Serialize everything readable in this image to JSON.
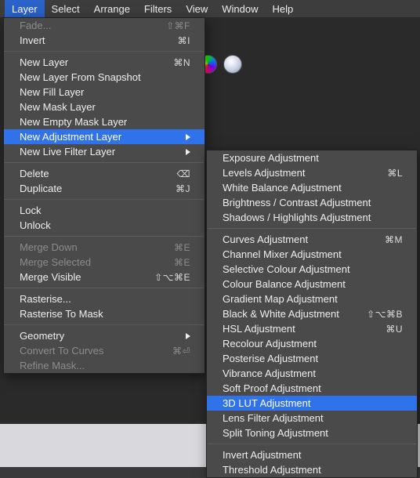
{
  "menubar": {
    "items": [
      "Layer",
      "Select",
      "Arrange",
      "Filters",
      "View",
      "Window",
      "Help"
    ],
    "active_index": 0
  },
  "layer_menu": {
    "groups": [
      [
        {
          "label": "Fade...",
          "shortcut": "⇧⌘F",
          "disabled": true
        },
        {
          "label": "Invert",
          "shortcut": "⌘I"
        }
      ],
      [
        {
          "label": "New Layer",
          "shortcut": "⌘N"
        },
        {
          "label": "New Layer From Snapshot"
        },
        {
          "label": "New Fill Layer"
        },
        {
          "label": "New Mask Layer"
        },
        {
          "label": "New Empty Mask Layer"
        },
        {
          "label": "New Adjustment Layer",
          "submenu": true,
          "highlight": true
        },
        {
          "label": "New Live Filter Layer",
          "submenu": true
        }
      ],
      [
        {
          "label": "Delete",
          "shortcut": "⌫"
        },
        {
          "label": "Duplicate",
          "shortcut": "⌘J"
        }
      ],
      [
        {
          "label": "Lock"
        },
        {
          "label": "Unlock"
        }
      ],
      [
        {
          "label": "Merge Down",
          "shortcut": "⌘E",
          "disabled": true
        },
        {
          "label": "Merge Selected",
          "shortcut": "⌘E",
          "disabled": true
        },
        {
          "label": "Merge Visible",
          "shortcut": "⇧⌥⌘E"
        }
      ],
      [
        {
          "label": "Rasterise..."
        },
        {
          "label": "Rasterise To Mask"
        }
      ],
      [
        {
          "label": "Geometry",
          "submenu": true
        },
        {
          "label": "Convert To Curves",
          "shortcut": "⌘⏎",
          "disabled": true
        },
        {
          "label": "Refine Mask...",
          "disabled": true
        }
      ]
    ]
  },
  "adjustment_submenu": {
    "groups": [
      [
        {
          "label": "Exposure Adjustment"
        },
        {
          "label": "Levels Adjustment",
          "shortcut": "⌘L"
        },
        {
          "label": "White Balance Adjustment"
        },
        {
          "label": "Brightness / Contrast Adjustment"
        },
        {
          "label": "Shadows / Highlights Adjustment"
        }
      ],
      [
        {
          "label": "Curves Adjustment",
          "shortcut": "⌘M"
        },
        {
          "label": "Channel Mixer Adjustment"
        },
        {
          "label": "Selective Colour Adjustment"
        },
        {
          "label": "Colour Balance Adjustment"
        },
        {
          "label": "Gradient Map Adjustment"
        },
        {
          "label": "Black & White Adjustment",
          "shortcut": "⇧⌥⌘B"
        },
        {
          "label": "HSL Adjustment",
          "shortcut": "⌘U"
        },
        {
          "label": "Recolour Adjustment"
        },
        {
          "label": "Posterise Adjustment"
        },
        {
          "label": "Vibrance Adjustment"
        },
        {
          "label": "Soft Proof Adjustment"
        },
        {
          "label": "3D LUT Adjustment",
          "highlight": true
        },
        {
          "label": "Lens Filter Adjustment"
        },
        {
          "label": "Split Toning Adjustment"
        }
      ],
      [
        {
          "label": "Invert Adjustment"
        },
        {
          "label": "Threshold Adjustment"
        }
      ]
    ]
  }
}
